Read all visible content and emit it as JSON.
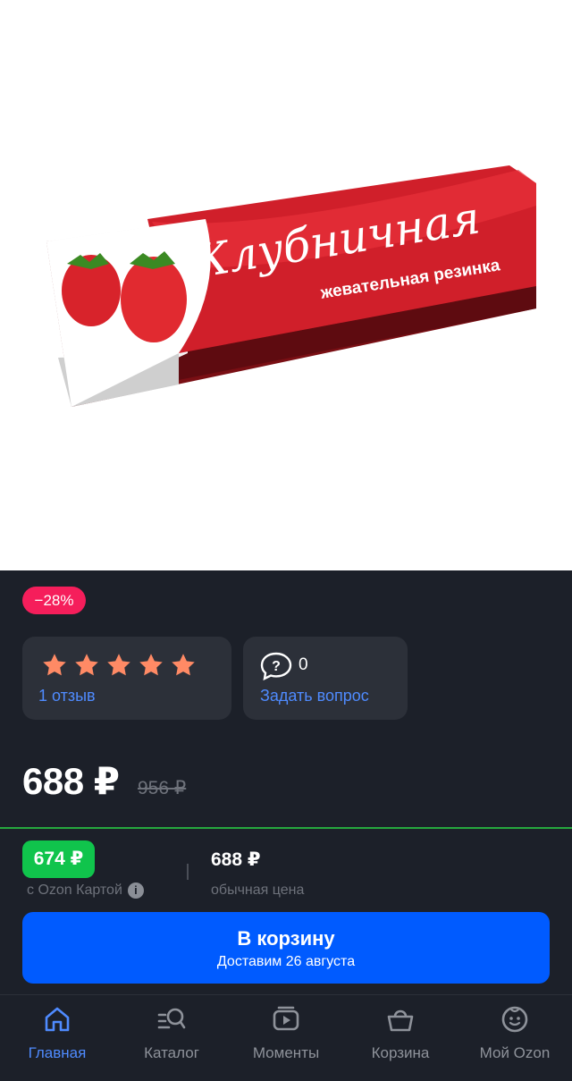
{
  "product": {
    "image_title": "Клубничная",
    "image_subtitle": "жевательная резинка",
    "discount_badge": "−28%"
  },
  "rating": {
    "stars": 5,
    "reviews_link": "1 отзыв"
  },
  "questions": {
    "count": "0",
    "ask_link": "Задать вопрос"
  },
  "price": {
    "current": "688 ₽",
    "old": "956 ₽",
    "card_price": "674 ₽",
    "card_caption": "с Ozon Картой",
    "regular_price": "688 ₽",
    "regular_caption": "обычная цена"
  },
  "cart_button": {
    "label": "В корзину",
    "delivery": "Доставим 26 августа"
  },
  "tabbar": {
    "items": [
      {
        "label": "Главная",
        "icon": "home-icon",
        "active": true
      },
      {
        "label": "Каталог",
        "icon": "catalog-search-icon",
        "active": false
      },
      {
        "label": "Моменты",
        "icon": "video-play-icon",
        "active": false
      },
      {
        "label": "Корзина",
        "icon": "basket-icon",
        "active": false
      },
      {
        "label": "Мой Ozon",
        "icon": "profile-face-icon",
        "active": false
      }
    ]
  },
  "colors": {
    "accent_blue": "#005bff",
    "link_blue": "#4f8bff",
    "discount_pink": "#f51e5b",
    "card_green": "#10c44c",
    "star_orange": "#ff8a65",
    "background": "#1c2029"
  }
}
